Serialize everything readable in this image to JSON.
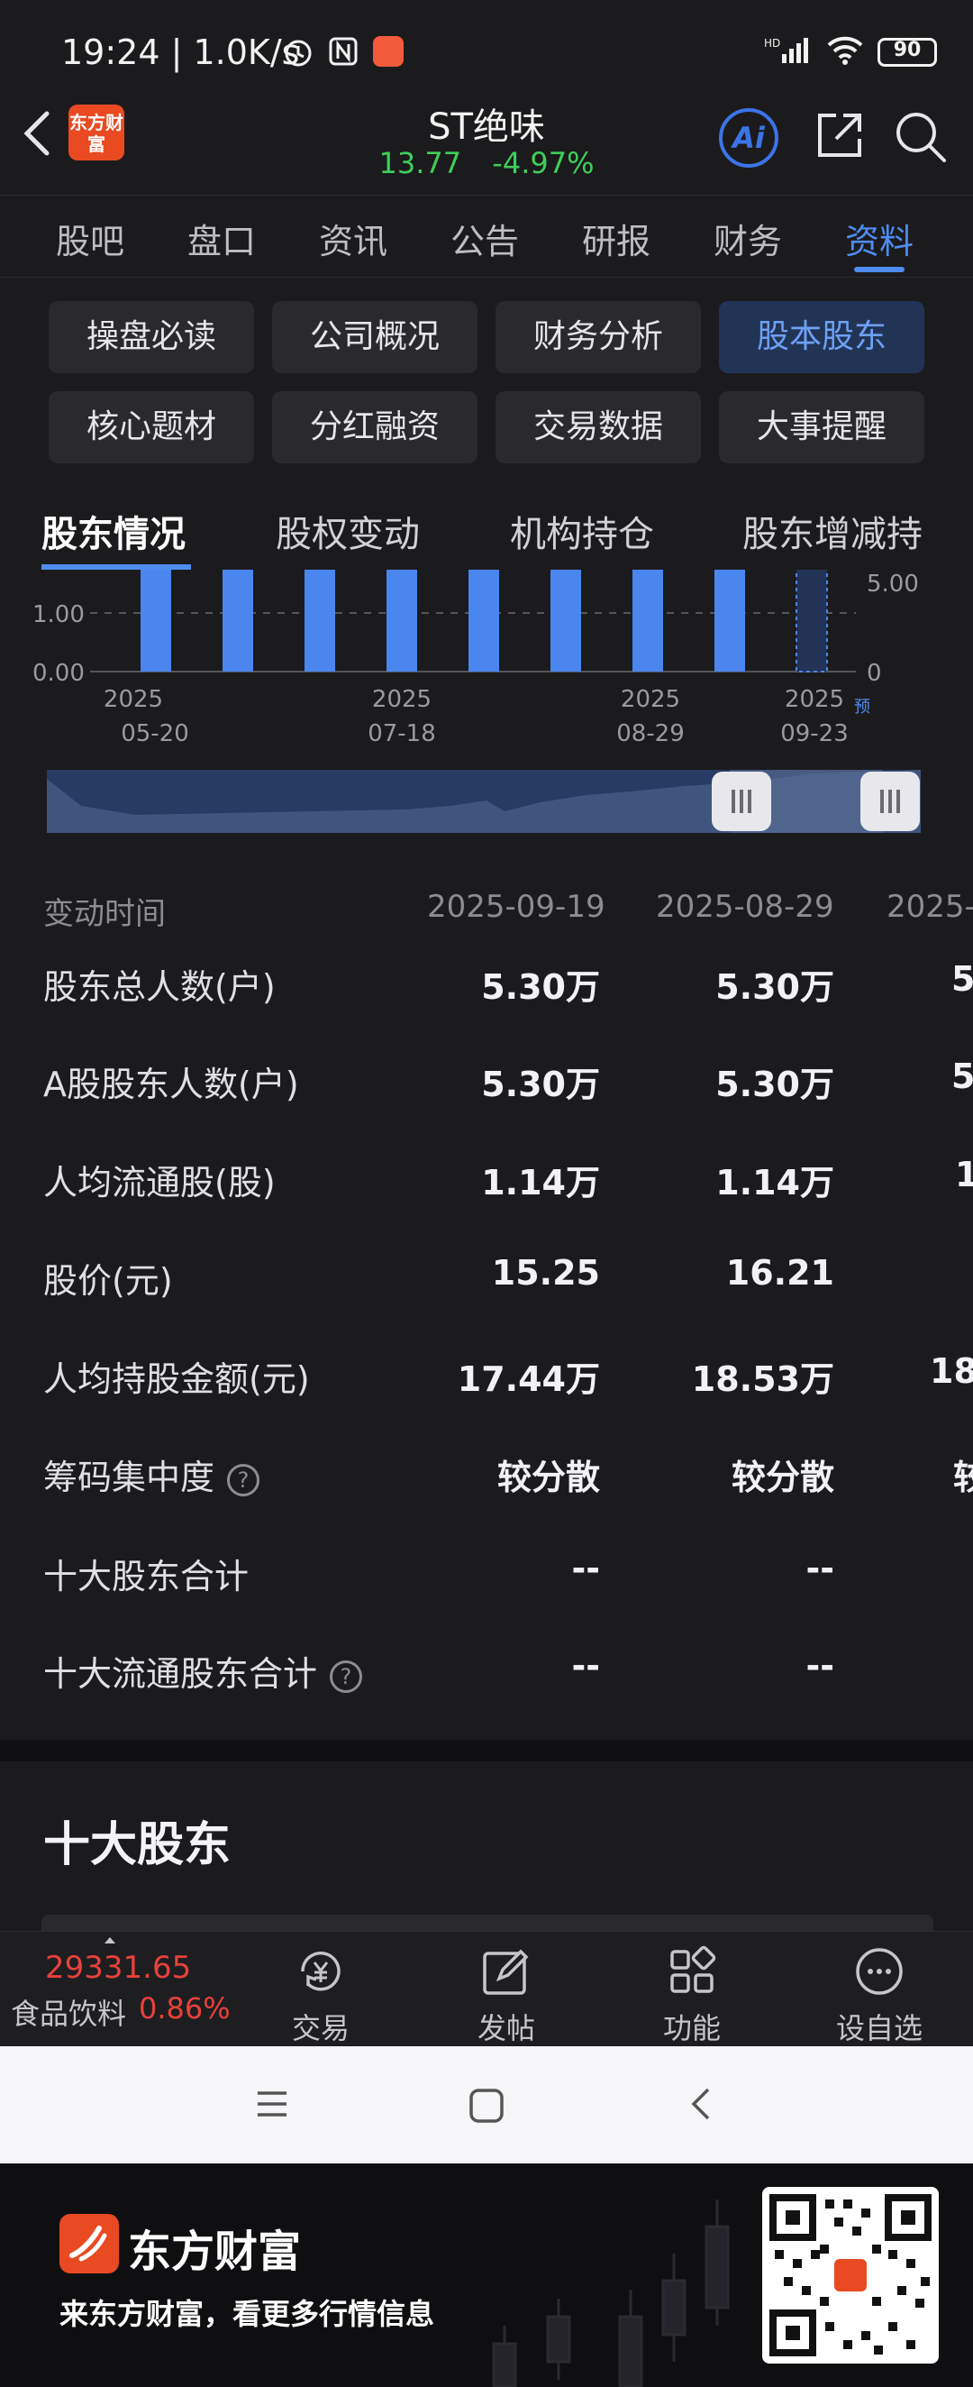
{
  "status_bar": {
    "time": "19:24 | 1.0K/s",
    "battery": "90"
  },
  "header": {
    "title": "ST绝味",
    "price": "13.77",
    "change": "-4.97%",
    "ai_label": "Ai",
    "logo_text": "东方财富"
  },
  "main_tabs": [
    {
      "label": "股吧"
    },
    {
      "label": "盘口"
    },
    {
      "label": "资讯"
    },
    {
      "label": "公告"
    },
    {
      "label": "研报"
    },
    {
      "label": "财务"
    },
    {
      "label": "资料"
    }
  ],
  "sub_chips": [
    {
      "label": "操盘必读"
    },
    {
      "label": "公司概况"
    },
    {
      "label": "财务分析"
    },
    {
      "label": "股本股东"
    },
    {
      "label": "核心题材"
    },
    {
      "label": "分红融资"
    },
    {
      "label": "交易数据"
    },
    {
      "label": "大事提醒"
    }
  ],
  "shareholder_tabs": [
    {
      "label": "股东情况"
    },
    {
      "label": "股权变动"
    },
    {
      "label": "机构持仓"
    },
    {
      "label": "股东增减持"
    }
  ],
  "chart_data": {
    "type": "bar",
    "left_axis_ticks": [
      "1.00",
      "0.00"
    ],
    "right_axis_ticks": [
      "5.00",
      "0"
    ],
    "x_tick_labels": [
      {
        "year": "2025",
        "date": "05-20"
      },
      {
        "year": "2025",
        "date": "07-18"
      },
      {
        "year": "2025",
        "date": "08-29"
      },
      {
        "year": "2025",
        "date": "09-23"
      }
    ],
    "forecast_mark": "预",
    "bar_count": 9,
    "last_bar_forecast": true,
    "bar_color": "#4a86ee"
  },
  "table": {
    "header_label": "变动时间",
    "dates": [
      "2025-09-19",
      "2025-08-29",
      "2025-"
    ],
    "rows": [
      {
        "label": "股东总人数(户)",
        "values": [
          "5.30万",
          "5.30万",
          "5"
        ]
      },
      {
        "label": "A股股东人数(户)",
        "values": [
          "5.30万",
          "5.30万",
          "5"
        ]
      },
      {
        "label": "人均流通股(股)",
        "values": [
          "1.14万",
          "1.14万",
          "1"
        ]
      },
      {
        "label": "股价(元)",
        "values": [
          "15.25",
          "16.21",
          ""
        ]
      },
      {
        "label": "人均持股金额(元)",
        "values": [
          "17.44万",
          "18.53万",
          "18"
        ]
      },
      {
        "label": "筹码集中度",
        "values": [
          "较分散",
          "较分散",
          "较"
        ],
        "help": true
      },
      {
        "label": "十大股东合计",
        "values": [
          "--",
          "--",
          ""
        ]
      },
      {
        "label": "十大流通股东合计",
        "values": [
          "--",
          "--",
          ""
        ],
        "help": true
      }
    ]
  },
  "section_title": "十大股东",
  "bottom_bar": {
    "index_value": "29331.65",
    "index_name": "食品饮料",
    "index_change": "0.86%",
    "items": [
      {
        "label": "交易"
      },
      {
        "label": "发帖"
      },
      {
        "label": "功能"
      },
      {
        "label": "设自选"
      }
    ]
  },
  "footer": {
    "brand": "东方财富",
    "slogan": "来东方财富，看更多行情信息"
  },
  "colors": {
    "accent": "#4f8cf0",
    "down": "#3ecf5a",
    "up": "#e8413b",
    "brand": "#e94a22"
  }
}
